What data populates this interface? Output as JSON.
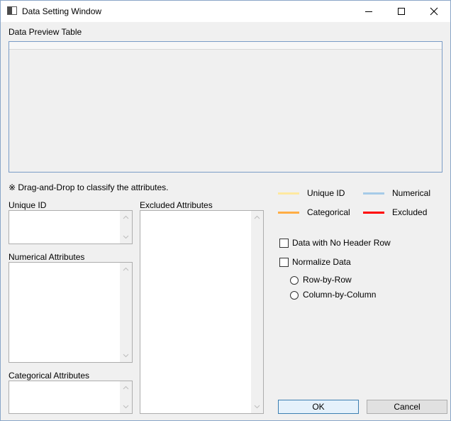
{
  "window": {
    "title": "Data Setting Window",
    "icons": {
      "minimize": "minimize-icon",
      "maximize": "maximize-icon",
      "close": "close-icon"
    }
  },
  "preview": {
    "label": "Data Preview Table"
  },
  "hint": "※ Drag-and-Drop to classify the attributes.",
  "lists": {
    "unique_id": "Unique ID",
    "numerical": "Numerical Attributes",
    "categorical": "Categorical Attributes",
    "excluded": "Excluded Attributes"
  },
  "legend": [
    {
      "label": "Unique ID",
      "color": "#ffe9a0"
    },
    {
      "label": "Numerical",
      "color": "#a6cbe8"
    },
    {
      "label": "Categorical",
      "color": "#ffad45"
    },
    {
      "label": "Excluded",
      "color": "#ff0000"
    }
  ],
  "options": {
    "no_header": "Data with No Header Row",
    "normalize": "Normalize Data",
    "row_by_row": "Row-by-Row",
    "column_by_column": "Column-by-Column"
  },
  "buttons": {
    "ok": "OK",
    "cancel": "Cancel"
  }
}
